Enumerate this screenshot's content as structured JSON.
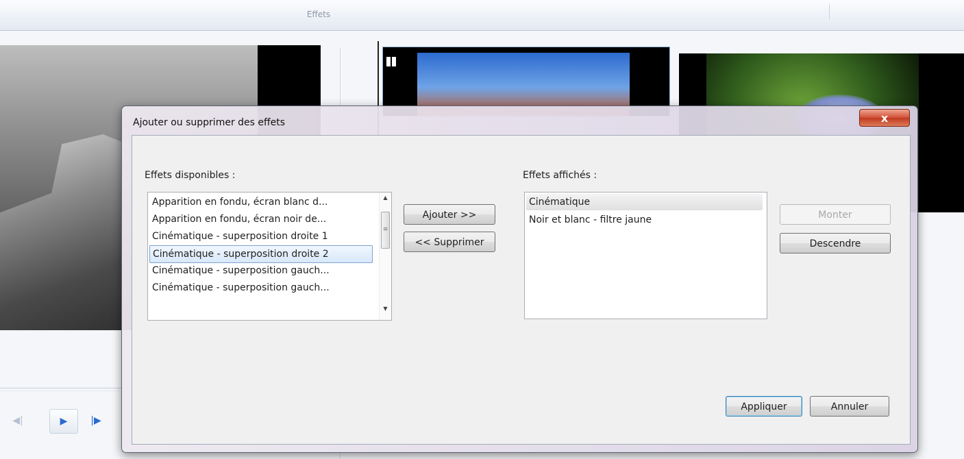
{
  "app": {
    "ribbon_title": "Effets"
  },
  "player": {
    "prev_icon": "step-back-icon",
    "play_icon": "play-icon",
    "next_icon": "step-forward-icon"
  },
  "dialog": {
    "title": "Ajouter ou supprimer des effets",
    "close_glyph": "x",
    "available_label": "Effets disponibles :",
    "shown_label": "Effets affichés :",
    "available_items": [
      "Apparition en fondu, écran blanc d...",
      "Apparition en fondu, écran noir de...",
      "Cinématique - superposition droite 1",
      "Cinématique - superposition droite 2",
      "Cinématique - superposition gauch...",
      "Cinématique - superposition gauch..."
    ],
    "available_selected_index": 3,
    "shown_items": [
      "Cinématique",
      "Noir et blanc - filtre jaune"
    ],
    "shown_selected_index": 0,
    "buttons": {
      "add": "Ajouter >>",
      "remove": "<< Supprimer",
      "up": "Monter",
      "down": "Descendre",
      "apply": "Appliquer",
      "cancel": "Annuler"
    }
  }
}
